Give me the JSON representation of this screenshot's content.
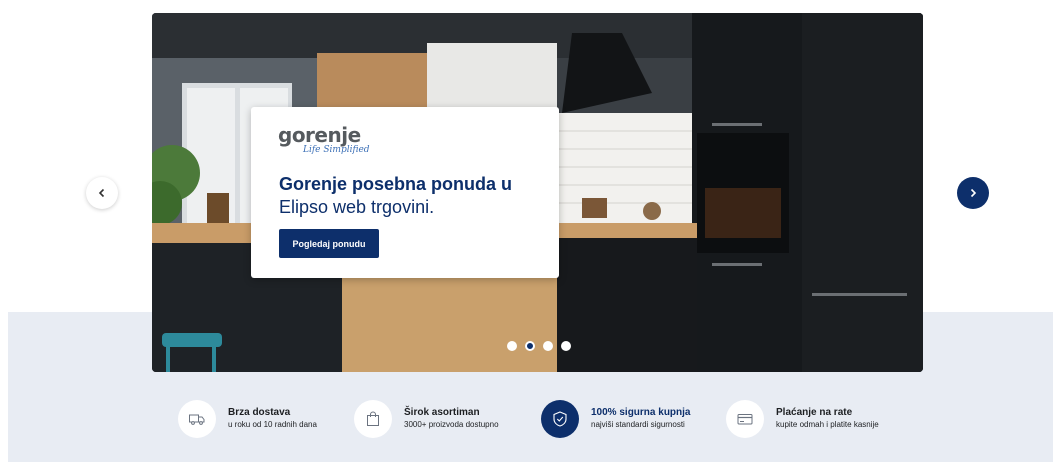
{
  "hero": {
    "logo_word": "gorenje",
    "logo_tagline": "Life Simplified",
    "headline_bold": "Gorenje posebna ponuda u",
    "headline_light": "Elipso web trgovini.",
    "cta_label": "Pogledaj ponudu",
    "slides_count": 4,
    "active_slide": 2,
    "prev_icon": "chevron-left-icon",
    "next_icon": "chevron-right-icon"
  },
  "features": [
    {
      "title": "Brza dostava",
      "subtitle": "u roku od 10 radnih dana",
      "icon": "truck-icon"
    },
    {
      "title": "Širok asortiman",
      "subtitle": "3000+ proizvoda dostupno",
      "icon": "shopping-bag-icon"
    },
    {
      "title": "100% sigurna kupnja",
      "subtitle": "najviši standardi sigurnosti",
      "icon": "shield-icon"
    },
    {
      "title": "Plaćanje na rate",
      "subtitle": "kupite odmah i platite kasnije",
      "icon": "credit-card-icon"
    }
  ],
  "colors": {
    "brand": "#0d2f6b",
    "band_bg": "#e8ecf3"
  }
}
